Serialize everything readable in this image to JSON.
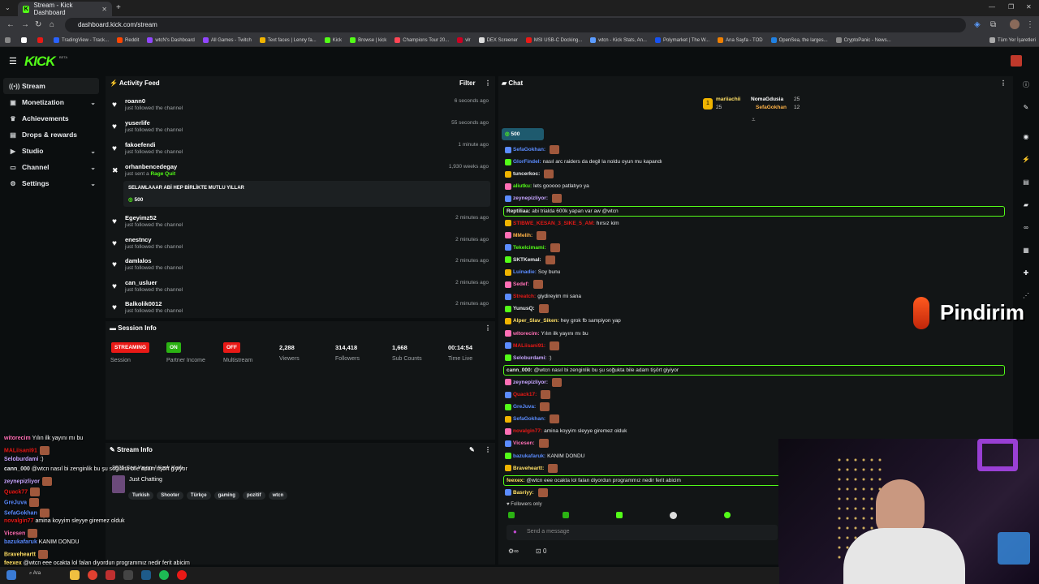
{
  "browser": {
    "tabs": [
      {
        "title": "Stream - Kick Dashboard",
        "active": true
      }
    ],
    "new_tab": "+",
    "url": "dashboard.kick.com/stream",
    "bookmarks": [
      "TradingView - Track...",
      "Reddit",
      "wtcN's Dashboard",
      "All Games - Twitch",
      "Text faces | Lenny fa...",
      "Kick",
      "Browse | kick",
      "Champions Tour 20...",
      "vlr",
      "DEX Screener",
      "MSI USB-C Docking...",
      "wtcn - Kick Stats, An...",
      "Polymarket | The W...",
      "Ana Sayfa - TOD",
      "OpenSea, the larges...",
      "CryptoPanic - News..."
    ],
    "all_bookmarks": "Tüm Yer İşaretleri"
  },
  "kick": {
    "logo": "KICK",
    "beta": "BETA"
  },
  "sidebar": {
    "items": [
      {
        "label": "Stream",
        "icon": "broadcast-icon",
        "expandable": false,
        "active": true
      },
      {
        "label": "Monetization",
        "icon": "money-icon",
        "expandable": true
      },
      {
        "label": "Achievements",
        "icon": "trophy-icon",
        "expandable": false
      },
      {
        "label": "Drops & rewards",
        "icon": "gift-icon",
        "expandable": false
      },
      {
        "label": "Studio",
        "icon": "studio-icon",
        "expandable": true
      },
      {
        "label": "Channel",
        "icon": "channel-icon",
        "expandable": true
      },
      {
        "label": "Settings",
        "icon": "gear-icon",
        "expandable": true
      }
    ]
  },
  "activity_feed": {
    "title": "Activity Feed",
    "filter_label": "Filter",
    "items": [
      {
        "name": "roann0",
        "action": "just followed the channel",
        "time": "6 seconds ago"
      },
      {
        "name": "yuserlife",
        "action": "just followed the channel",
        "time": "55 seconds ago"
      },
      {
        "name": "fakoefendi",
        "action": "just followed the channel",
        "time": "1 minute ago"
      },
      {
        "name": "orhanbencedegay",
        "action": "just sent a",
        "gift": "Rage Quit",
        "time": "1,930 weeks ago",
        "message": "SELAMLAAAR ABİ HEP BİRLİKTE MUTLU YILLAR",
        "amount": "500"
      },
      {
        "name": "Egeyimz52",
        "action": "just followed the channel",
        "time": "2 minutes ago"
      },
      {
        "name": "enestncy",
        "action": "just followed the channel",
        "time": "2 minutes ago"
      },
      {
        "name": "damlalos",
        "action": "just followed the channel",
        "time": "2 minutes ago"
      },
      {
        "name": "can_usluer",
        "action": "just followed the channel",
        "time": "2 minutes ago"
      },
      {
        "name": "Balkolik0012",
        "action": "just followed the channel",
        "time": "2 minutes ago"
      }
    ]
  },
  "session_info": {
    "title": "Session Info",
    "badges": [
      {
        "label": "STREAMING",
        "caption": "Session",
        "color": "#e91916"
      },
      {
        "label": "ON",
        "caption": "Partner Income",
        "color": "#2bb313"
      },
      {
        "label": "OFF",
        "caption": "Multistream",
        "color": "#e91916"
      }
    ],
    "stats": [
      {
        "value": "2,288",
        "label": "Viewers"
      },
      {
        "value": "314,418",
        "label": "Followers"
      },
      {
        "value": "1,668",
        "label": "Sub Counts"
      },
      {
        "value": "00:14:54",
        "label": "Time Live"
      }
    ]
  },
  "stream_info": {
    "title": "Stream Info",
    "stream_title": "2025 Son Yayını | Karlı Karlı",
    "category": "Just Chatting",
    "tags": [
      "Turkish",
      "Shooter",
      "Türkçe",
      "gaming",
      "pozitif",
      "wtcn"
    ]
  },
  "chat": {
    "title": "Chat",
    "leaderboard": [
      {
        "name": "mariiachii",
        "count": "25"
      },
      {
        "name": "NomaGdusia",
        "count": "25"
      },
      {
        "name": "SefaGokhan",
        "count": "12"
      }
    ],
    "pinned_gift": "500",
    "followers_only": "Followers only",
    "input_placeholder": "Send a message",
    "counter": "0",
    "messages": [
      {
        "user": "SefaGokhan",
        "color": "#5b8cff",
        "text": "",
        "emote": true
      },
      {
        "user": "GlorFindel",
        "color": "#5b8cff",
        "text": "nasıl arc raiders da degil la noldu oyun mu kapandı"
      },
      {
        "user": "tuncerkoc",
        "color": "#e8eaed",
        "text": "",
        "emote": true
      },
      {
        "user": "aliutku",
        "color": "#53fc18",
        "text": "lets gooooo patlatıyo ya"
      },
      {
        "user": "zeynepizliyor",
        "color": "#c7a6ff",
        "text": "",
        "emote": true
      },
      {
        "user": "Reptiliaa",
        "color": "#e8eaed",
        "text": "abi trialda 600k yapan var aw @wtcn",
        "highlight": true
      },
      {
        "user": "STIBWE_KESAN_3_SIKE_5_AM",
        "color": "#e91916",
        "text": "hırsız kim"
      },
      {
        "user": "MMelih",
        "color": "#ffb347",
        "text": "",
        "emote": true
      },
      {
        "user": "Tekelcimami",
        "color": "#53fc18",
        "text": "",
        "emote": true
      },
      {
        "user": "SKTKemal",
        "color": "#e8eaed",
        "text": "",
        "emote": true
      },
      {
        "user": "Luinadie",
        "color": "#5b8cff",
        "text": "Soy bunu"
      },
      {
        "user": "Sedef",
        "color": "#ff6fb5",
        "text": "",
        "emote": true
      },
      {
        "user": "Streatch",
        "color": "#e91916",
        "text": "giydireyim mi sana"
      },
      {
        "user": "YunusQ",
        "color": "#e8eaed",
        "text": "",
        "emote": true
      },
      {
        "user": "Alper_Slav_Siken",
        "color": "#ffe066",
        "text": "hey grok fb sampiyon yap"
      },
      {
        "user": "wltorecim",
        "color": "#ff6fb5",
        "text": "Yılın ilk yayını mı bu"
      },
      {
        "user": "MALiisani91",
        "color": "#e91916",
        "text": "",
        "emote": true
      },
      {
        "user": "Seloburdami",
        "color": "#c7a6ff",
        "text": ":)"
      },
      {
        "user": "cann_000",
        "color": "#e8eaed",
        "text": "@wtcn nasıl bi zenginlik bu şu soğukta bile adam tişört giyiyor",
        "highlight": true
      },
      {
        "user": "zeynepizliyor",
        "color": "#c7a6ff",
        "text": "",
        "emote": true
      },
      {
        "user": "Quack17",
        "color": "#e91916",
        "text": "",
        "emote": true
      },
      {
        "user": "GreJuva",
        "color": "#5b8cff",
        "text": "",
        "emote": true
      },
      {
        "user": "SefaGokhan",
        "color": "#5b8cff",
        "text": "",
        "emote": true
      },
      {
        "user": "novalgin77",
        "color": "#e91916",
        "text": "amina koyyim sleyye giremez olduk"
      },
      {
        "user": "Vicesen",
        "color": "#ff6fb5",
        "text": "",
        "emote": true
      },
      {
        "user": "bazukafaruk",
        "color": "#5b8cff",
        "text": "KANIM DONDU"
      },
      {
        "user": "Braveheartt",
        "color": "#ffe066",
        "text": "",
        "emote": true
      },
      {
        "user": "feexex",
        "color": "#ffe066",
        "text": "@wtcn eee ocakta lol falan diyordun programmız nedir ferit abicim",
        "highlight": true
      },
      {
        "user": "Basriyy",
        "color": "#ffe066",
        "text": "",
        "emote": true
      }
    ]
  },
  "overlay": {
    "brand": "Pindirim",
    "chat": [
      {
        "user": "witorecim",
        "text": "Yılın ilk yayını mı bu",
        "color": "#ff6fb5"
      },
      {
        "user": "MALiisani91",
        "text": "",
        "color": "#e91916"
      },
      {
        "user": "Seloburdami",
        "text": ":)",
        "color": "#c7a6ff"
      },
      {
        "user": "cann_000",
        "text": "@wtcn nasıl bi zenginlik bu şu soğukta bile adam tişört giyiyor",
        "color": "#e8eaed"
      },
      {
        "user": "zeynepizliyor",
        "text": "",
        "color": "#c7a6ff"
      },
      {
        "user": "Quack77",
        "text": "",
        "color": "#e91916"
      },
      {
        "user": "GreJuva",
        "text": "",
        "color": "#5b8cff"
      },
      {
        "user": "SefaGokhan",
        "text": "",
        "color": "#5b8cff"
      },
      {
        "user": "novalgin77",
        "text": "amina koyyim sleyye giremez olduk",
        "color": "#e91916"
      },
      {
        "user": "Vicesen",
        "text": "",
        "color": "#ff6fb5"
      },
      {
        "user": "bazukafaruk",
        "text": "KANIM DONDU",
        "color": "#5b8cff"
      },
      {
        "user": "Braveheartt",
        "text": "",
        "color": "#ffe066"
      },
      {
        "user": "feexex",
        "text": "@wtcn eee ocakta lol falan diyordun programmız nedir ferit abicim",
        "color": "#ffe066"
      }
    ]
  },
  "taskbar": {
    "search": "Ara"
  }
}
